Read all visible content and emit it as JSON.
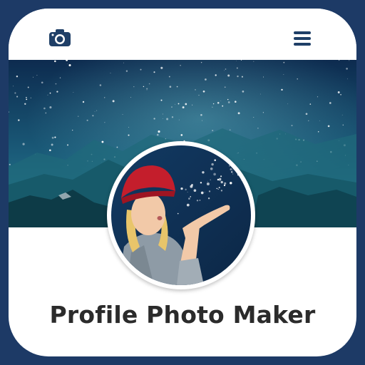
{
  "app": {
    "title": "Profile Photo Maker"
  },
  "toolbar": {
    "camera_icon": "camera-icon",
    "menu_icon": "hamburger-menu-icon"
  },
  "cover_photo": {
    "subject": "starry-night-mountains",
    "colors": {
      "sky_top": "#0d2b4f",
      "sky_mid": "#1f6f86",
      "mountain_dark": "#0d3b47",
      "mountain_mid": "#175a6a"
    }
  },
  "profile_photo": {
    "subject": "woman-in-red-hat-blowing-sparkles"
  },
  "colors": {
    "frame": "#1d3a66",
    "icon_accent": "#1f3f67",
    "title_text": "#2b2b2b"
  }
}
